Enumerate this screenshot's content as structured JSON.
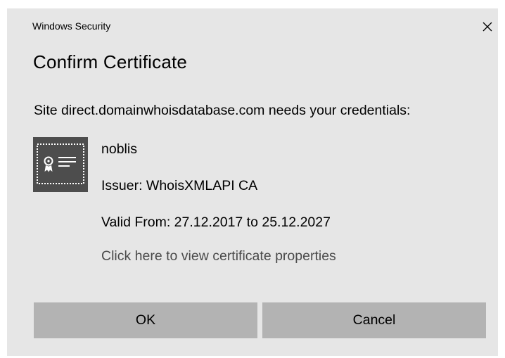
{
  "window": {
    "title": "Windows Security",
    "close_icon": "close-icon"
  },
  "dialog": {
    "heading": "Confirm Certificate",
    "prompt": "Site direct.domainwhoisdatabase.com needs your credentials:"
  },
  "certificate": {
    "icon": "certificate-icon",
    "name": "noblis",
    "issuer": "Issuer: WhoisXMLAPI CA",
    "valid": "Valid From: 27.12.2017 to 25.12.2027",
    "link": "Click here to view certificate properties"
  },
  "buttons": {
    "ok": "OK",
    "cancel": "Cancel"
  },
  "colors": {
    "dialog_background": "#e6e6e6",
    "button_background": "#b3b3b3",
    "link_text": "#4a4a4a",
    "icon_dark": "#4d4d4d"
  }
}
